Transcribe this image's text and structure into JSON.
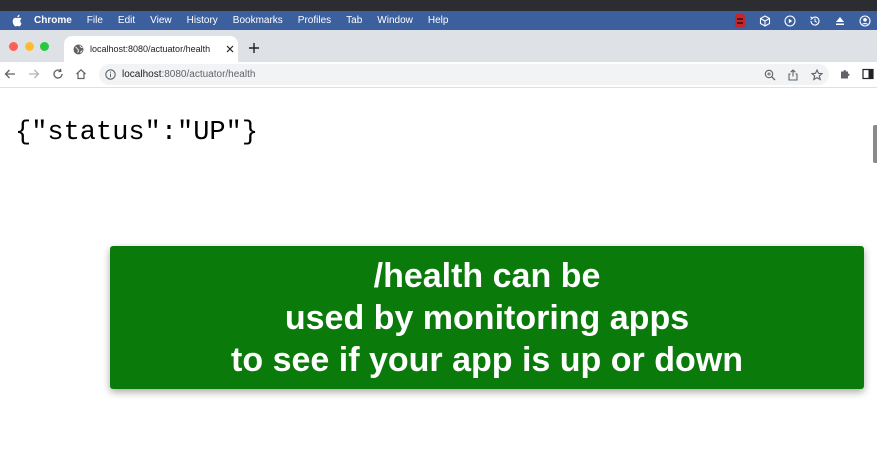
{
  "menubar": {
    "app_name": "Chrome",
    "items": [
      "File",
      "Edit",
      "View",
      "History",
      "Bookmarks",
      "Profiles",
      "Tab",
      "Window",
      "Help"
    ]
  },
  "tab": {
    "title": "localhost:8080/actuator/health"
  },
  "address_bar": {
    "host": "localhost",
    "path": ":8080/actuator/health"
  },
  "content": {
    "json_text": "{\"status\":\"UP\"}"
  },
  "banner": {
    "lines": [
      "/health can be",
      "used by monitoring apps",
      "to see if your app is up or down"
    ]
  },
  "colors": {
    "menubar_bg": "#3c5f9e",
    "banner_bg": "#0a7a0a",
    "tabstrip_bg": "#dee1e6"
  }
}
